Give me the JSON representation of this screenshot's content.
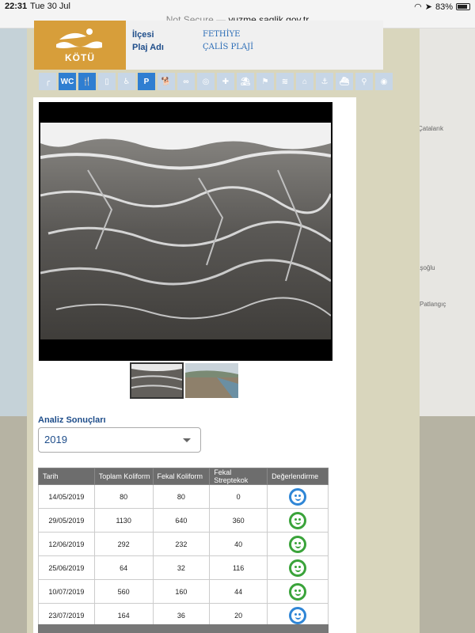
{
  "status_bar": {
    "time": "22:31",
    "date": "Tue 30 Jul",
    "battery": "83%"
  },
  "url_bar": {
    "security": "Not Secure —",
    "domain": "yuzme.saglik.gov.tr"
  },
  "map_labels": [
    "Çatalarık",
    "aşoğlu",
    "Patlangıç"
  ],
  "beach": {
    "status_label": "KÖTÜ",
    "status_color": "#d79e3a",
    "fields": [
      {
        "key": "İlçesi",
        "value": "FETHİYE"
      },
      {
        "key": "Plaj Adı",
        "value": "ÇALİS PLAJİ"
      }
    ]
  },
  "amenities": [
    {
      "name": "shower-icon",
      "glyph": "╭",
      "active": false
    },
    {
      "name": "wc-icon",
      "glyph": "WC",
      "active": true
    },
    {
      "name": "restaurant-icon",
      "glyph": "🍴",
      "active": true
    },
    {
      "name": "changing-room-icon",
      "glyph": "▯",
      "active": false
    },
    {
      "name": "wheelchair-icon",
      "glyph": "♿",
      "active": false
    },
    {
      "name": "parking-icon",
      "glyph": "P",
      "active": true
    },
    {
      "name": "dog-icon",
      "glyph": "🐕",
      "active": false
    },
    {
      "name": "binoculars-icon",
      "glyph": "∞",
      "active": false
    },
    {
      "name": "lifebuoy-icon",
      "glyph": "◎",
      "active": false
    },
    {
      "name": "first-aid-icon",
      "glyph": "✚",
      "active": false
    },
    {
      "name": "lifeguard-icon",
      "glyph": "⛱",
      "active": false
    },
    {
      "name": "flag-icon",
      "glyph": "⚑",
      "active": false
    },
    {
      "name": "swimming-icon",
      "glyph": "≋",
      "active": false
    },
    {
      "name": "house-icon",
      "glyph": "⌂",
      "active": false
    },
    {
      "name": "anchor-icon",
      "glyph": "⚓",
      "active": false
    },
    {
      "name": "boat-icon",
      "glyph": "⛴",
      "active": false
    },
    {
      "name": "fishing-icon",
      "glyph": "⚲",
      "active": false
    },
    {
      "name": "fish-icon",
      "glyph": "◉",
      "active": false
    }
  ],
  "analysis": {
    "title": "Analiz Sonuçları",
    "selected_year": "2019",
    "columns": [
      "Tarih",
      "Toplam Koliform",
      "Fekal Koliform",
      "Fekal Streptekok",
      "Değerlendirme"
    ],
    "rows": [
      {
        "date": "14/05/2019",
        "total": "80",
        "fecal": "80",
        "strep": "0",
        "rating": "very-good"
      },
      {
        "date": "29/05/2019",
        "total": "1130",
        "fecal": "640",
        "strep": "360",
        "rating": "good"
      },
      {
        "date": "12/06/2019",
        "total": "292",
        "fecal": "232",
        "strep": "40",
        "rating": "good"
      },
      {
        "date": "25/06/2019",
        "total": "64",
        "fecal": "32",
        "strep": "116",
        "rating": "good"
      },
      {
        "date": "10/07/2019",
        "total": "560",
        "fecal": "160",
        "strep": "44",
        "rating": "good"
      },
      {
        "date": "23/07/2019",
        "total": "164",
        "fecal": "36",
        "strep": "20",
        "rating": "very-good"
      }
    ],
    "rating_colors": {
      "very-good": "#2f86d6",
      "good": "#3aa33a"
    }
  }
}
